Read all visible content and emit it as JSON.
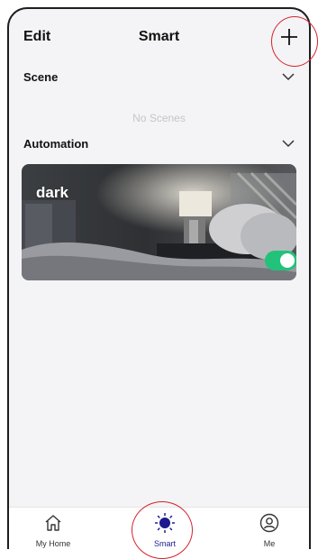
{
  "header": {
    "edit_label": "Edit",
    "title": "Smart",
    "add_icon": "plus-icon"
  },
  "scene": {
    "label": "Scene",
    "empty_text": "No Scenes"
  },
  "automation": {
    "label": "Automation",
    "cards": [
      {
        "name": "dark",
        "enabled": true
      }
    ]
  },
  "tabbar": {
    "tabs": [
      {
        "label": "My Home",
        "icon": "home-icon",
        "active": false
      },
      {
        "label": "Smart",
        "icon": "sun-icon",
        "active": true
      },
      {
        "label": "Me",
        "icon": "user-icon",
        "active": false
      }
    ]
  },
  "colors": {
    "accent": "#1d1a8c",
    "toggle_on": "#22c27a",
    "callout": "#d6212c"
  }
}
